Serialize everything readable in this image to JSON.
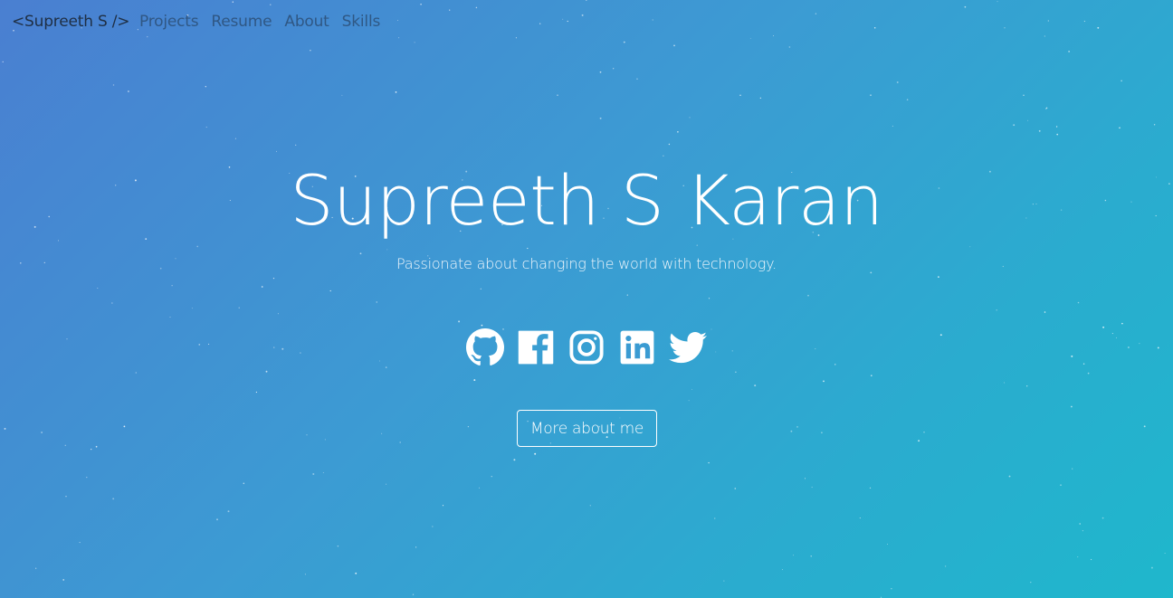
{
  "nav": {
    "brand": "<Supreeth S />",
    "links": [
      "Projects",
      "Resume",
      "About",
      "Skills"
    ]
  },
  "hero": {
    "title": "Supreeth S Karan",
    "tagline": "Passionate about changing the world with technology."
  },
  "socials": [
    {
      "icon": "github-icon"
    },
    {
      "icon": "facebook-icon"
    },
    {
      "icon": "instagram-icon"
    },
    {
      "icon": "linkedin-icon"
    },
    {
      "icon": "twitter-icon"
    }
  ],
  "cta": {
    "label": "More about me"
  },
  "colors": {
    "gradient_start": "#4a7fd1",
    "gradient_end": "#1fb7cc",
    "brand_text": "#1f2f44",
    "nav_text": "#2c4f77",
    "hero_text": "#ffffff"
  }
}
